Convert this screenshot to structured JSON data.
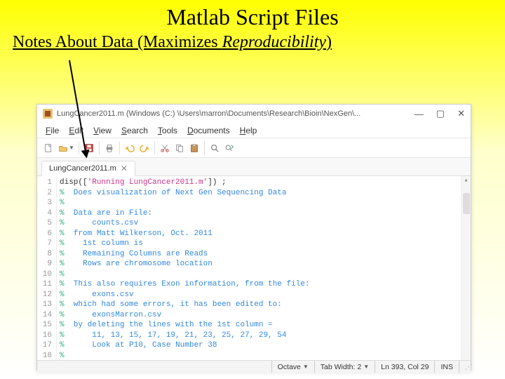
{
  "slide": {
    "title": "Matlab Script Files",
    "subtitle_prefix": "Notes About Data (Maximizes ",
    "subtitle_italic": "Reproducibility",
    "subtitle_suffix": ")"
  },
  "window": {
    "title_path": "LungCancer2011.m (Windows (C:) \\Users\\marron\\Documents\\Research\\Bioin\\NexGen\\...",
    "controls": {
      "min": "—",
      "max": "▢",
      "close": "✕"
    }
  },
  "menu": [
    "File",
    "Edit",
    "View",
    "Search",
    "Tools",
    "Documents",
    "Help"
  ],
  "menu_ul": [
    "F",
    "E",
    "V",
    "S",
    "T",
    "D",
    "H"
  ],
  "toolbar_icons": [
    "new-doc-icon",
    "open-icon",
    "save-icon",
    "print-icon",
    "undo-icon",
    "redo-icon",
    "cut-icon",
    "copy-icon",
    "paste-icon",
    "find-icon",
    "replace-icon"
  ],
  "tab": {
    "label": "LungCancer2011.m",
    "close": "✕"
  },
  "code": {
    "lines": [
      {
        "n": 1,
        "pre": "",
        "pct": "",
        "txt": "disp(['Running LungCancer2011.m']) ;",
        "is_code": true
      },
      {
        "n": 2,
        "pre": "",
        "pct": "%",
        "txt": "  Does visualization of Next Gen Sequencing Data"
      },
      {
        "n": 3,
        "pre": "",
        "pct": "%",
        "txt": ""
      },
      {
        "n": 4,
        "pre": "",
        "pct": "%",
        "txt": "  Data are in File:"
      },
      {
        "n": 5,
        "pre": "",
        "pct": "%",
        "txt": "      counts.csv"
      },
      {
        "n": 6,
        "pre": "",
        "pct": "%",
        "txt": "  from Matt Wilkerson, Oct. 2011"
      },
      {
        "n": 7,
        "pre": "",
        "pct": "%",
        "txt": "    1st column is"
      },
      {
        "n": 8,
        "pre": "",
        "pct": "%",
        "txt": "    Remaining Columns are Reads"
      },
      {
        "n": 9,
        "pre": "",
        "pct": "%",
        "txt": "    Rows are chromosome location"
      },
      {
        "n": 10,
        "pre": "",
        "pct": "%",
        "txt": ""
      },
      {
        "n": 11,
        "pre": "",
        "pct": "%",
        "txt": "  This also requires Exon information, from the file:"
      },
      {
        "n": 12,
        "pre": "",
        "pct": "%",
        "txt": "      exons.csv"
      },
      {
        "n": 13,
        "pre": "",
        "pct": "%",
        "txt": "  which had some errors, it has been edited to:"
      },
      {
        "n": 14,
        "pre": "",
        "pct": "%",
        "txt": "      exonsMarron.csv"
      },
      {
        "n": 15,
        "pre": "",
        "pct": "%",
        "txt": "  by deleting the lines with the 1st column ="
      },
      {
        "n": 16,
        "pre": "",
        "pct": "%",
        "txt": "      11, 13, 15, 17, 19, 21, 23, 25, 27, 29, 54"
      },
      {
        "n": 17,
        "pre": "",
        "pct": "%",
        "txt": "      Look at P10, Case Number 38"
      },
      {
        "n": 18,
        "pre": "",
        "pct": "%",
        "txt": ""
      }
    ]
  },
  "statusbar": {
    "lang": "Octave",
    "tabwidth_label": "Tab Width:",
    "tabwidth_value": "2",
    "pos": "Ln 393, Col 29",
    "mode": "INS"
  }
}
